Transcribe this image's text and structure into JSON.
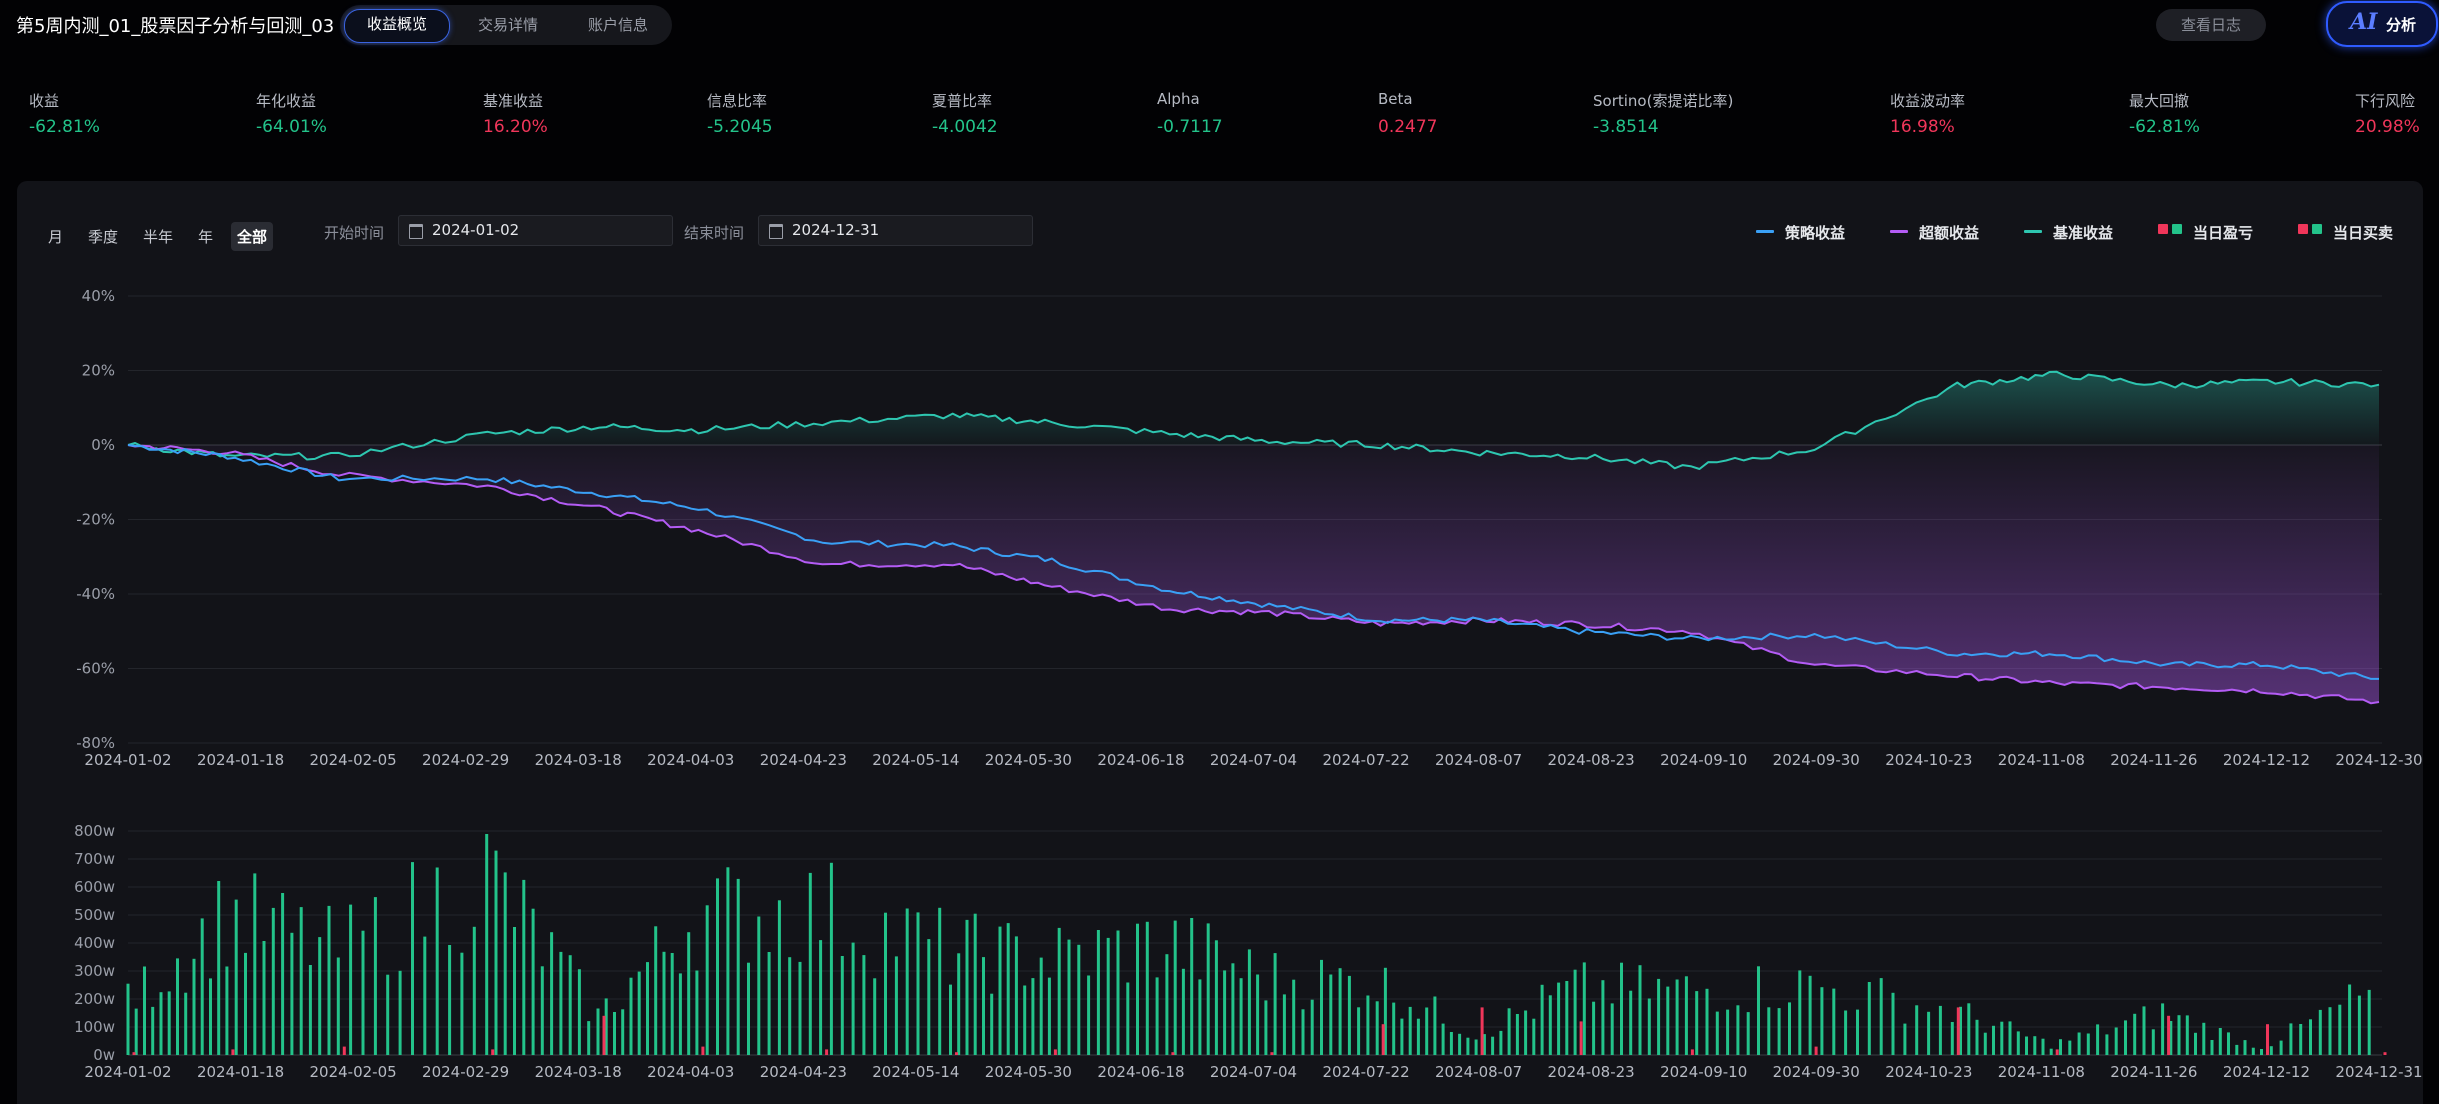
{
  "header": {
    "title": "第5周内测_01_股票因子分析与回测_03",
    "tabs": [
      {
        "label": "收益概览",
        "active": true
      },
      {
        "label": "交易详情",
        "active": false
      },
      {
        "label": "账户信息",
        "active": false
      }
    ],
    "log_button": "查看日志",
    "ai_button": {
      "icon_text": "AI",
      "label": "分析"
    }
  },
  "metrics": [
    {
      "label": "收益",
      "value": "-62.81%",
      "color": "green"
    },
    {
      "label": "年化收益",
      "value": "-64.01%",
      "color": "green"
    },
    {
      "label": "基准收益",
      "value": "16.20%",
      "color": "red"
    },
    {
      "label": "信息比率",
      "value": "-5.2045",
      "color": "green"
    },
    {
      "label": "夏普比率",
      "value": "-4.0042",
      "color": "green"
    },
    {
      "label": "Alpha",
      "value": "-0.7117",
      "color": "green"
    },
    {
      "label": "Beta",
      "value": "0.2477",
      "color": "red"
    },
    {
      "label": "Sortino(索提诺比率)",
      "value": "-3.8514",
      "color": "green"
    },
    {
      "label": "收益波动率",
      "value": "16.98%",
      "color": "red"
    },
    {
      "label": "最大回撤",
      "value": "-62.81%",
      "color": "green"
    },
    {
      "label": "下行风险",
      "value": "20.98%",
      "color": "red"
    }
  ],
  "filters": {
    "periods": [
      {
        "label": "月",
        "active": false
      },
      {
        "label": "季度",
        "active": false
      },
      {
        "label": "半年",
        "active": false
      },
      {
        "label": "年",
        "active": false
      },
      {
        "label": "全部",
        "active": true
      }
    ],
    "start_label": "开始时间",
    "start_value": "2024-01-02",
    "end_label": "结束时间",
    "end_value": "2024-12-31"
  },
  "legend": [
    {
      "label": "策略收益",
      "kind": "line",
      "colors": [
        "#3aa0f5"
      ]
    },
    {
      "label": "超额收益",
      "kind": "line",
      "colors": [
        "#b45cf5"
      ]
    },
    {
      "label": "基准收益",
      "kind": "line",
      "colors": [
        "#2ec6b0"
      ]
    },
    {
      "label": "当日盈亏",
      "kind": "square",
      "colors": [
        "#f0365a",
        "#23c38a"
      ]
    },
    {
      "label": "当日买卖",
      "kind": "square",
      "colors": [
        "#f0365a",
        "#23c38a"
      ]
    }
  ],
  "colors": {
    "strategy": "#3aa0f5",
    "excess": "#b45cf5",
    "benchmark": "#2ec6b0",
    "bar_positive": "#23c38a",
    "bar_negative": "#f0365a",
    "green": "#23c38a",
    "red": "#f0365a"
  },
  "chart_data": [
    {
      "type": "line",
      "ylim": [
        -80,
        40
      ],
      "y_ticks": [
        "40%",
        "20%",
        "0%",
        "-20%",
        "-40%",
        "-60%",
        "-80%"
      ],
      "x_ticks": [
        "2024-01-02",
        "2024-01-18",
        "2024-02-05",
        "2024-02-29",
        "2024-03-18",
        "2024-04-03",
        "2024-04-23",
        "2024-05-14",
        "2024-05-30",
        "2024-06-18",
        "2024-07-04",
        "2024-07-22",
        "2024-08-07",
        "2024-08-23",
        "2024-09-10",
        "2024-09-30",
        "2024-10-23",
        "2024-11-08",
        "2024-11-26",
        "2024-12-12",
        "2024-12-30"
      ],
      "grid": true,
      "legend": "top-right",
      "x": [
        "2024-01-02",
        "2024-01-18",
        "2024-02-05",
        "2024-02-29",
        "2024-03-18",
        "2024-04-03",
        "2024-04-23",
        "2024-05-14",
        "2024-05-30",
        "2024-06-18",
        "2024-07-04",
        "2024-07-22",
        "2024-08-07",
        "2024-08-23",
        "2024-09-10",
        "2024-09-30",
        "2024-10-23",
        "2024-11-08",
        "2024-11-26",
        "2024-12-12",
        "2024-12-30"
      ],
      "series": [
        {
          "name": "策略收益",
          "values": [
            0,
            -3,
            -9,
            -9,
            -13,
            -17,
            -26,
            -27,
            -31,
            -39,
            -43,
            -47,
            -47,
            -50,
            -52,
            -51,
            -56,
            -56,
            -59,
            -59,
            -62.8
          ]
        },
        {
          "name": "超额收益",
          "values": [
            0,
            -2,
            -8,
            -11,
            -17,
            -23,
            -32,
            -32,
            -38,
            -44,
            -45,
            -48,
            -47,
            -48,
            -50,
            -59,
            -62,
            -64,
            -65,
            -66,
            -69
          ]
        },
        {
          "name": "基准收益",
          "values": [
            0,
            -3,
            -3,
            3,
            5,
            4,
            6,
            8,
            6,
            3,
            1,
            0,
            -2,
            -3,
            -6,
            -1,
            16,
            19,
            16,
            17,
            16.2
          ]
        }
      ]
    },
    {
      "type": "bar",
      "ylim": [
        0,
        800
      ],
      "y_ticks": [
        "800w",
        "700w",
        "600w",
        "500w",
        "400w",
        "300w",
        "200w",
        "100w",
        "0w"
      ],
      "x_ticks": [
        "2024-01-02",
        "2024-01-18",
        "2024-02-05",
        "2024-02-29",
        "2024-03-18",
        "2024-04-03",
        "2024-04-23",
        "2024-05-14",
        "2024-05-30",
        "2024-06-18",
        "2024-07-04",
        "2024-07-22",
        "2024-08-07",
        "2024-08-23",
        "2024-09-10",
        "2024-09-30",
        "2024-10-23",
        "2024-11-08",
        "2024-11-26",
        "2024-12-12",
        "2024-12-31"
      ],
      "grid": true,
      "x": [
        "2024-01-02",
        "2024-01-18",
        "2024-02-05",
        "2024-02-29",
        "2024-03-18",
        "2024-04-03",
        "2024-04-23",
        "2024-05-14",
        "2024-05-30",
        "2024-06-18",
        "2024-07-04",
        "2024-07-22",
        "2024-08-07",
        "2024-08-23",
        "2024-09-10",
        "2024-09-30",
        "2024-10-23",
        "2024-11-08",
        "2024-11-26",
        "2024-12-12",
        "2024-12-31"
      ],
      "series": [
        {
          "name": "当日买卖",
          "values": [
            200,
            540,
            400,
            700,
            150,
            540,
            560,
            400,
            370,
            430,
            300,
            280,
            80,
            260,
            250,
            270,
            170,
            40,
            160,
            30,
            260
          ]
        },
        {
          "name": "当日盈亏",
          "values": [
            -10,
            -20,
            -30,
            -20,
            -140,
            -30,
            -20,
            -10,
            -20,
            -10,
            -10,
            -110,
            -170,
            -120,
            -20,
            -30,
            -170,
            -20,
            -140,
            -110,
            -10
          ]
        }
      ]
    }
  ]
}
